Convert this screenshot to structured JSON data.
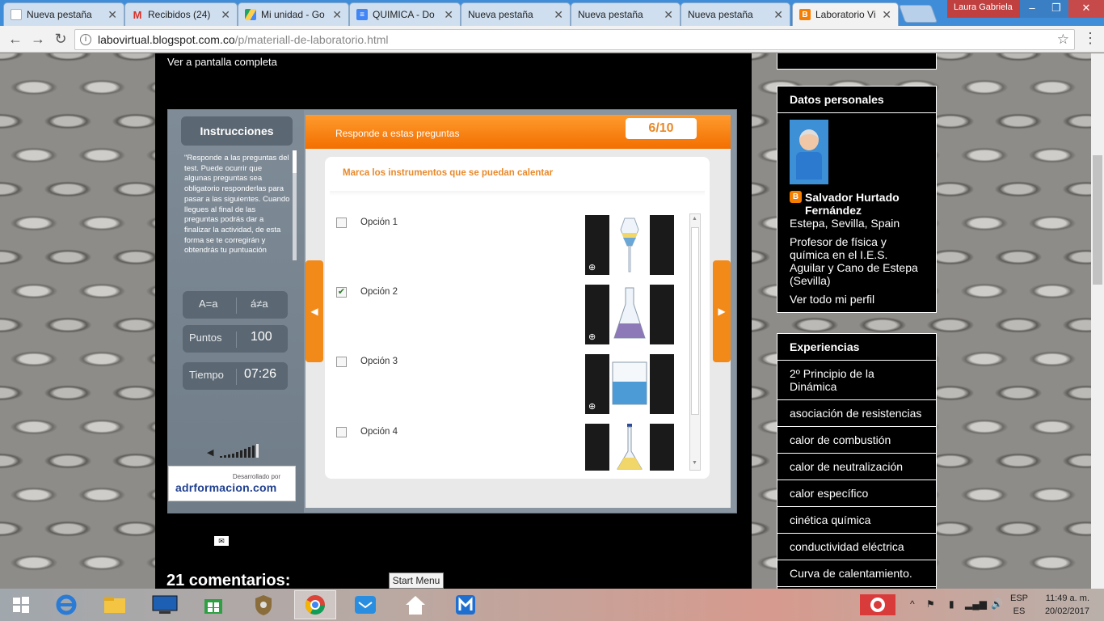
{
  "browser": {
    "tabs": [
      {
        "title": "Nueva pestaña",
        "icon": "page-icon",
        "color": "#9aa"
      },
      {
        "title": "Recibidos (24)",
        "icon": "gmail-icon",
        "color": "#d93025"
      },
      {
        "title": "Mi unidad - Go",
        "icon": "drive-icon",
        "color": "#1fa463"
      },
      {
        "title": "QUIMICA - Do",
        "icon": "docs-icon",
        "color": "#4285f4"
      },
      {
        "title": "Nueva pestaña",
        "icon": "page-icon",
        "color": "#9aa"
      },
      {
        "title": "Nueva pestaña",
        "icon": "page-icon",
        "color": "#9aa"
      },
      {
        "title": "Nueva pestaña",
        "icon": "page-icon",
        "color": "#9aa"
      },
      {
        "title": "Laboratorio Vi",
        "icon": "blogger-icon",
        "color": "#f57d00"
      }
    ],
    "user": "Laura Gabriela",
    "url_host": "labovirtual.blogspot.com.co",
    "url_path": "/p/materiall-de-laboratorio.html"
  },
  "main": {
    "fullscreen_link": "Ver a pantalla completa",
    "comments_heading": "21 comentarios:"
  },
  "activity": {
    "instructions_title": "Instrucciones",
    "instructions_text": "\"Responde a las preguntas del test. Puede ocurrir que algunas preguntas sea obligatorio responderlas para pasar a las siguientes. Cuando llegues al final de las preguntas podrás dar a finalizar la actividad, de esta forma se te corregirán y obtendrás tu puntuación",
    "case_equal": "A=a",
    "case_diff": "á≠a",
    "points_label": "Puntos",
    "points_value": "100",
    "time_label": "Tiempo",
    "time_value": "07:26",
    "volume_level": 0.8,
    "developed_by": "Desarrollado por",
    "brand": "adrformacion.com",
    "header": "Responde a estas preguntas",
    "counter": "6/10",
    "question": "Marca los instrumentos que se puedan calentar",
    "options": [
      {
        "label": "Opción 1",
        "checked": false,
        "instrument": "separatory-funnel"
      },
      {
        "label": "Opción 2",
        "checked": true,
        "instrument": "erlenmeyer-flask"
      },
      {
        "label": "Opción 3",
        "checked": false,
        "instrument": "beaker"
      },
      {
        "label": "Opción 4",
        "checked": false,
        "instrument": "volumetric-flask"
      }
    ]
  },
  "sidebar": {
    "profile_heading": "Datos personales",
    "name": "Salvador Hurtado Fernández",
    "location": "Estepa, Sevilla, Spain",
    "bio": "Profesor de física y química en el I.E.S. Aguilar y Cano de Estepa (Sevilla)",
    "profile_link": "Ver todo mi perfil",
    "experiences_heading": "Experiencias",
    "experiences": [
      "2º Principio de la Dinámica",
      "asociación de resistencias",
      "calor de combustión",
      "calor de neutralización",
      "calor específico",
      "cinética química",
      "conductividad eléctrica",
      "Curva de calentamiento."
    ]
  },
  "tooltip": "Start Menu",
  "taskbar": {
    "lang_top": "ESP",
    "lang_bottom": "ES",
    "time": "11:49 a. m.",
    "date": "20/02/2017"
  }
}
